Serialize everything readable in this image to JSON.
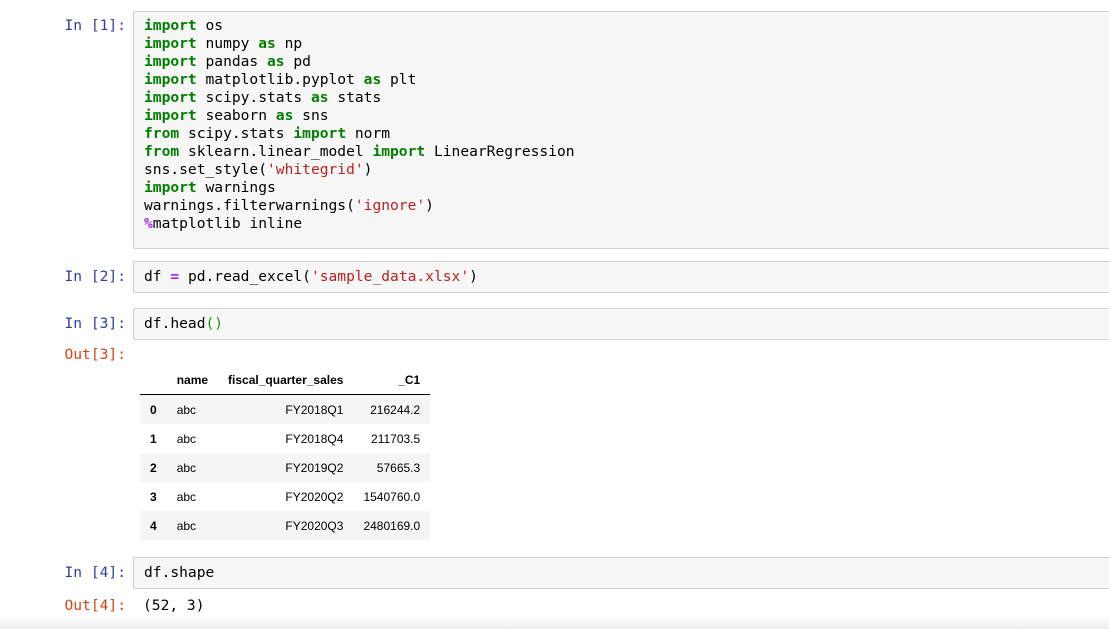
{
  "cells": [
    {
      "prompt": "In [1]:",
      "lines": [
        [
          {
            "t": "k",
            "v": "import"
          },
          {
            "t": "n",
            "v": " os"
          }
        ],
        [
          {
            "t": "k",
            "v": "import"
          },
          {
            "t": "n",
            "v": " numpy "
          },
          {
            "t": "k",
            "v": "as"
          },
          {
            "t": "n",
            "v": " np"
          }
        ],
        [
          {
            "t": "k",
            "v": "import"
          },
          {
            "t": "n",
            "v": " pandas "
          },
          {
            "t": "k",
            "v": "as"
          },
          {
            "t": "n",
            "v": " pd"
          }
        ],
        [
          {
            "t": "k",
            "v": "import"
          },
          {
            "t": "n",
            "v": " matplotlib.pyplot "
          },
          {
            "t": "k",
            "v": "as"
          },
          {
            "t": "n",
            "v": " plt"
          }
        ],
        [
          {
            "t": "k",
            "v": "import"
          },
          {
            "t": "n",
            "v": " scipy.stats "
          },
          {
            "t": "k",
            "v": "as"
          },
          {
            "t": "n",
            "v": " stats"
          }
        ],
        [
          {
            "t": "k",
            "v": "import"
          },
          {
            "t": "n",
            "v": " seaborn "
          },
          {
            "t": "k",
            "v": "as"
          },
          {
            "t": "n",
            "v": " sns"
          }
        ],
        [
          {
            "t": "k",
            "v": "from"
          },
          {
            "t": "n",
            "v": " scipy.stats "
          },
          {
            "t": "k",
            "v": "import"
          },
          {
            "t": "n",
            "v": " norm"
          }
        ],
        [
          {
            "t": "k",
            "v": "from"
          },
          {
            "t": "n",
            "v": " sklearn.linear_model "
          },
          {
            "t": "k",
            "v": "import"
          },
          {
            "t": "n",
            "v": " LinearRegression"
          }
        ],
        [
          {
            "t": "n",
            "v": "sns.set_style("
          },
          {
            "t": "s",
            "v": "'whitegrid'"
          },
          {
            "t": "n",
            "v": ")"
          }
        ],
        [
          {
            "t": "k",
            "v": "import"
          },
          {
            "t": "n",
            "v": " warnings"
          }
        ],
        [
          {
            "t": "n",
            "v": "warnings.filterwarnings("
          },
          {
            "t": "s",
            "v": "'ignore'"
          },
          {
            "t": "n",
            "v": ")"
          }
        ],
        [
          {
            "t": "o",
            "v": "%"
          },
          {
            "t": "n",
            "v": "matplotlib inline"
          }
        ]
      ]
    },
    {
      "prompt": "In [2]:",
      "lines": [
        [
          {
            "t": "n",
            "v": "df "
          },
          {
            "t": "o",
            "v": "="
          },
          {
            "t": "n",
            "v": " pd.read_excel("
          },
          {
            "t": "s",
            "v": "'sample_data.xlsx'"
          },
          {
            "t": "n",
            "v": ")"
          }
        ]
      ]
    },
    {
      "prompt": "In [3]:",
      "out_prompt": "Out[3]:",
      "lines": [
        [
          {
            "t": "n",
            "v": "df.head"
          },
          {
            "t": "p",
            "v": "()"
          }
        ]
      ],
      "table": {
        "columns": [
          "",
          "name",
          "fiscal_quarter_sales",
          "_C1"
        ],
        "rows": [
          [
            "0",
            "abc",
            "FY2018Q1",
            "216244.2"
          ],
          [
            "1",
            "abc",
            "FY2018Q4",
            "211703.5"
          ],
          [
            "2",
            "abc",
            "FY2019Q2",
            "57665.3"
          ],
          [
            "3",
            "abc",
            "FY2020Q2",
            "1540760.0"
          ],
          [
            "4",
            "abc",
            "FY2020Q3",
            "2480169.0"
          ]
        ]
      }
    },
    {
      "prompt": "In [4]:",
      "out_prompt": "Out[4]:",
      "lines": [
        [
          {
            "t": "n",
            "v": "df.shape"
          }
        ]
      ],
      "output_text": "(52, 3)"
    }
  ]
}
